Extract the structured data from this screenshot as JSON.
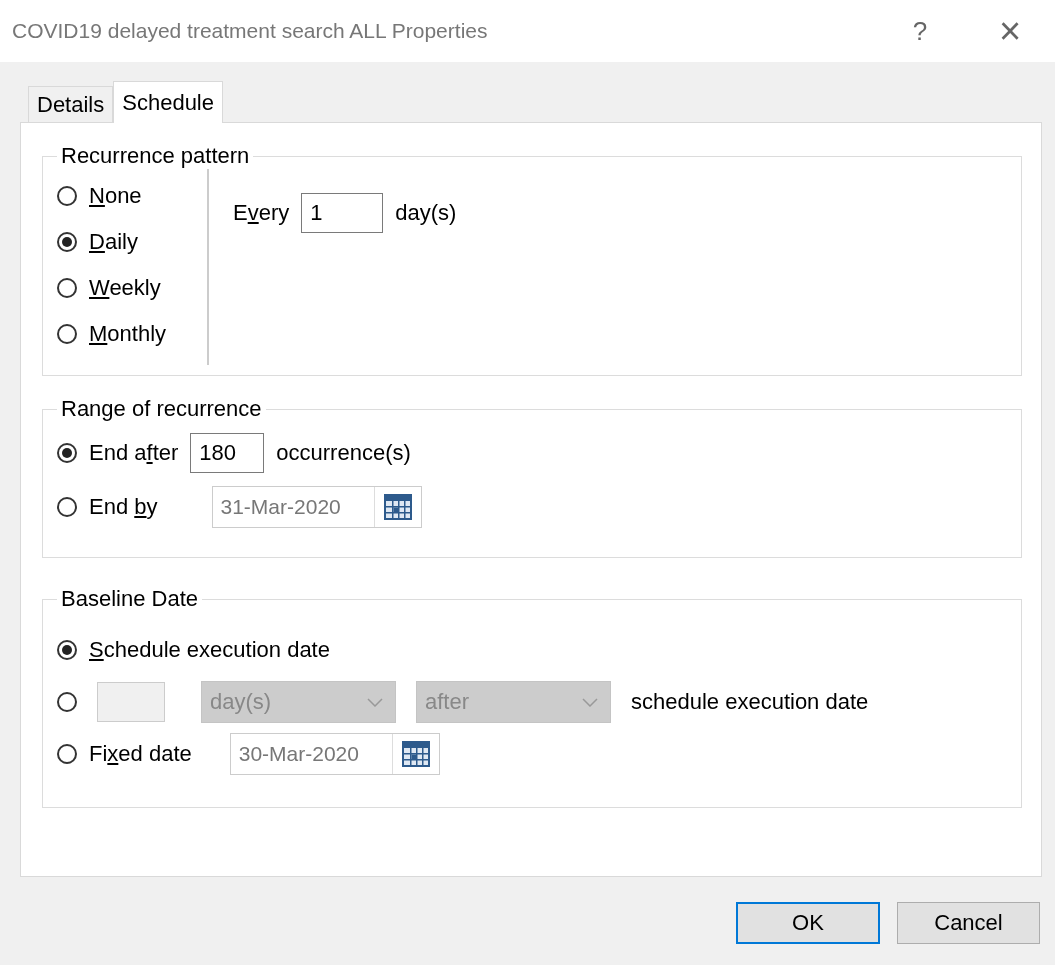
{
  "window": {
    "title": "COVID19 delayed treatment search ALL Properties",
    "help": "?",
    "close": "×"
  },
  "tabs": [
    {
      "label": "Details",
      "selected": false
    },
    {
      "label": "Schedule",
      "selected": true
    }
  ],
  "recurrence_pattern": {
    "title": "Recurrence pattern",
    "options": [
      {
        "label": [
          {
            "text": "N",
            "key": true
          },
          {
            "text": "one",
            "key": false
          }
        ],
        "selected": false
      },
      {
        "label": [
          {
            "text": "D",
            "key": true
          },
          {
            "text": "aily",
            "key": false
          }
        ],
        "selected": true
      },
      {
        "label": [
          {
            "text": "W",
            "key": true
          },
          {
            "text": "eekly",
            "key": false
          }
        ],
        "selected": false
      },
      {
        "label": [
          {
            "text": "M",
            "key": true
          },
          {
            "text": "onthly",
            "key": false
          }
        ],
        "selected": false
      }
    ],
    "every": {
      "label": [
        {
          "text": "E",
          "key": false
        },
        {
          "text": "v",
          "key": true
        },
        {
          "text": "ery",
          "key": false
        }
      ],
      "value": "1",
      "unit": "day(s)"
    }
  },
  "range_of_recurrence": {
    "title": "Range of recurrence",
    "rows": [
      {
        "kind": "count",
        "label": [
          {
            "text": "End a",
            "key": false
          },
          {
            "text": "f",
            "key": true
          },
          {
            "text": "ter",
            "key": false
          }
        ],
        "selected": true,
        "value": "180",
        "unit": "occurrence(s)"
      },
      {
        "kind": "date",
        "label": [
          {
            "text": "End ",
            "key": false
          },
          {
            "text": "b",
            "key": true
          },
          {
            "text": "y",
            "key": false
          }
        ],
        "selected": false,
        "value": "31-Mar-2020",
        "disabled": true
      }
    ]
  },
  "baseline_date": {
    "title": "Baseline Date",
    "rows": [
      {
        "kind": "plain",
        "label": [
          {
            "text": "S",
            "key": true
          },
          {
            "text": "chedule execution date",
            "key": false
          }
        ],
        "selected": true
      },
      {
        "kind": "offset",
        "selected": false,
        "unit": "day(s)",
        "direction": "after",
        "suffix": "schedule execution date",
        "disabled": true
      },
      {
        "kind": "date",
        "label": [
          {
            "text": "Fi",
            "key": false
          },
          {
            "text": "x",
            "key": true
          },
          {
            "text": "ed date",
            "key": false
          }
        ],
        "selected": false,
        "value": "30-Mar-2020",
        "disabled": true
      }
    ]
  },
  "buttons": [
    {
      "label": "OK",
      "default": true
    },
    {
      "label": "Cancel",
      "default": false
    }
  ]
}
